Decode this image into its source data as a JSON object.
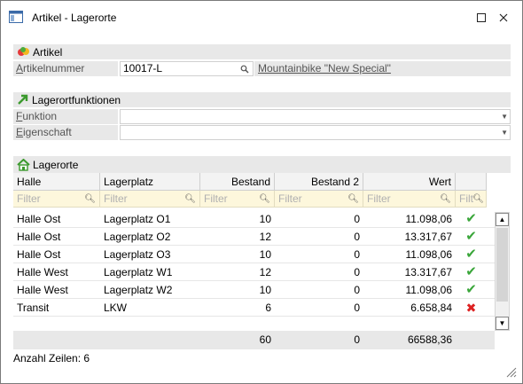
{
  "window": {
    "title": "Artikel - Lagerorte"
  },
  "artikel": {
    "section_label": "Artikel",
    "artikelnummer_label_mnemonic": "A",
    "artikelnummer_label_rest": "rtikelnummer",
    "artikelnummer_value": "10017-L",
    "description_link": "Mountainbike \"New Special\""
  },
  "lagerortfunktionen": {
    "section_label": "Lagerortfunktionen",
    "funktion_mnemonic": "F",
    "funktion_rest": "unktion",
    "funktion_value": "",
    "eigenschaft_mnemonic": "E",
    "eigenschaft_rest": "igenschaft",
    "eigenschaft_value": ""
  },
  "lagerorte": {
    "section_label": "Lagerorte",
    "columns": [
      "Halle",
      "Lagerplatz",
      "Bestand",
      "Bestand 2",
      "Wert",
      ""
    ],
    "filter_placeholders": [
      "Filter",
      "Filter",
      "Filter",
      "Filter",
      "Filter",
      "Filt"
    ],
    "rows": [
      {
        "halle": "Halle Ost",
        "lagerplatz": "Lagerplatz O1",
        "bestand": "10",
        "bestand2": "0",
        "wert": "11.098,06",
        "status": "ok"
      },
      {
        "halle": "Halle Ost",
        "lagerplatz": "Lagerplatz O2",
        "bestand": "12",
        "bestand2": "0",
        "wert": "13.317,67",
        "status": "ok"
      },
      {
        "halle": "Halle Ost",
        "lagerplatz": "Lagerplatz O3",
        "bestand": "10",
        "bestand2": "0",
        "wert": "11.098,06",
        "status": "ok"
      },
      {
        "halle": "Halle West",
        "lagerplatz": "Lagerplatz W1",
        "bestand": "12",
        "bestand2": "0",
        "wert": "13.317,67",
        "status": "ok"
      },
      {
        "halle": "Halle West",
        "lagerplatz": "Lagerplatz W2",
        "bestand": "10",
        "bestand2": "0",
        "wert": "11.098,06",
        "status": "ok"
      },
      {
        "halle": "Transit",
        "lagerplatz": "LKW",
        "bestand": "6",
        "bestand2": "0",
        "wert": "6.658,84",
        "status": "bad"
      }
    ],
    "totals": {
      "bestand": "60",
      "bestand2": "0",
      "wert": "66588,36"
    }
  },
  "rowcount_text": "Anzahl Zeilen: 6",
  "status_colors": {
    "ok": "#3aa63a",
    "bad": "#d22222"
  }
}
